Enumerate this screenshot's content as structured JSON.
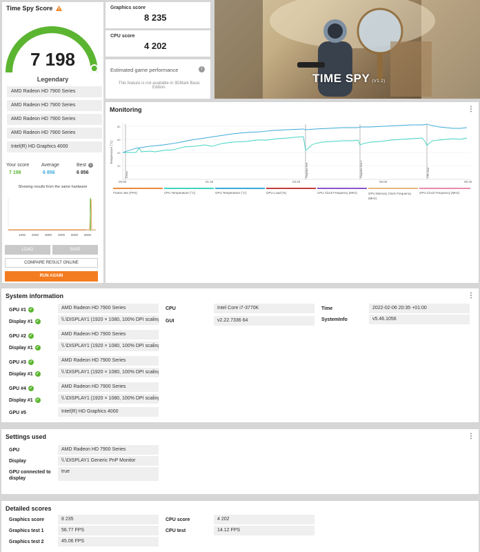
{
  "score_panel": {
    "title": "Time Spy Score",
    "score": "7 198",
    "rating": "Legendary",
    "gauge_fraction": 0.97,
    "gpu_list": [
      "AMD Radeon HD 7900 Series",
      "AMD Radeon HD 7900 Series",
      "AMD Radeon HD 7900 Series",
      "AMD Radeon HD 7900 Series",
      "Intel(R) HD Graphics 4000"
    ],
    "your_score_label": "Your score",
    "your_score": "7 198",
    "average_label": "Average",
    "average": "6 856",
    "best_label": "Best",
    "best": "6 856",
    "hardware_note": "Showing results from the same hardware",
    "histogram_ticks": [
      "1000",
      "2000",
      "3000",
      "4000",
      "5000",
      "6000"
    ],
    "load_label": "LOAD",
    "save_label": "SAVE",
    "compare_label": "COMPARE RESULT ONLINE",
    "run_again_label": "RUN AGAIN"
  },
  "graphics": {
    "label": "Graphics score",
    "value": "8 235"
  },
  "cpu": {
    "label": "CPU score",
    "value": "4 202"
  },
  "estimated": {
    "title": "Estimated game performance",
    "note": "This feature is not available in 3DMark Basic Edition."
  },
  "hero": {
    "title": "TIME SPY",
    "version": "(V1.2)"
  },
  "monitoring": {
    "title": "Monitoring",
    "y_label": "Temperature (°C)",
    "x_ticks": [
      "00:00",
      "01:40",
      "03:20",
      "05:00",
      "06:40"
    ],
    "markers": [
      "Demo",
      "Graphics test",
      "Graphics test 2",
      "CPU test"
    ],
    "legend": [
      {
        "label": "Frame rate (FPS)",
        "color": "#e98a3c"
      },
      {
        "label": "CPU Temperature (°C)",
        "color": "#3fd3c1"
      },
      {
        "label": "GPU Temperature (°C)",
        "color": "#3aa8d8"
      },
      {
        "label": "GPU Load (%)",
        "color": "#c23b3b"
      },
      {
        "label": "CPU Clock Frequency (MHz)",
        "color": "#8b55c9"
      },
      {
        "label": "GPU Memory Clock Frequency (MHz)",
        "color": "#e3b87a"
      },
      {
        "label": "GPU Clock Frequency (MHz)",
        "color": "#e98aa8"
      }
    ]
  },
  "system_info": {
    "title": "System information",
    "gpu1_label": "GPU #1",
    "gpu1": "AMD Radeon HD 7900 Series",
    "display1a_label": "Display #1",
    "display1a": "\\\\.\\DISPLAY1 (1920 × 1080, 100% DPI scaling)",
    "gpu2_label": "GPU #2",
    "gpu2": "AMD Radeon HD 7900 Series",
    "display1b_label": "Display #1",
    "display1b": "\\\\.\\DISPLAY1 (1920 × 1080, 100% DPI scaling)",
    "gpu3_label": "GPU #3",
    "gpu3": "AMD Radeon HD 7900 Series",
    "display1c_label": "Display #1",
    "display1c": "\\\\.\\DISPLAY1 (1920 × 1080, 100% DPI scaling)",
    "gpu4_label": "GPU #4",
    "gpu4": "AMD Radeon HD 7900 Series",
    "display1d_label": "Display #1",
    "display1d": "\\\\.\\DISPLAY1 (1920 × 1080, 100% DPI scaling)",
    "gpu5_label": "GPU #5",
    "gpu5": "Intel(R) HD Graphics 4000",
    "cpu_label": "CPU",
    "cpu": "Intel Core i7-3770K",
    "gui_label": "GUI",
    "gui": "v2.22.7336 64",
    "time_label": "Time",
    "time": "2022-02-06 20:35 +01:00",
    "sysinfo_label": "SystemInfo",
    "sysinfo": "v5.46.1056"
  },
  "settings": {
    "title": "Settings used",
    "gpu_label": "GPU",
    "gpu": "AMD Radeon HD 7900 Series",
    "display_label": "Display",
    "display": "\\\\.\\DISPLAY1 Generic PnP Monitor",
    "connected_label": "GPU connected to display",
    "connected": "true"
  },
  "detailed": {
    "title": "Detailed scores",
    "gs_label": "Graphics score",
    "gs": "8 235",
    "gt1_label": "Graphics test 1",
    "gt1": "56.77 FPS",
    "gt2_label": "Graphics test 2",
    "gt2": "45.06 FPS",
    "cs_label": "CPU score",
    "cs": "4 202",
    "ct_label": "CPU test",
    "ct": "14.12 FPS"
  }
}
